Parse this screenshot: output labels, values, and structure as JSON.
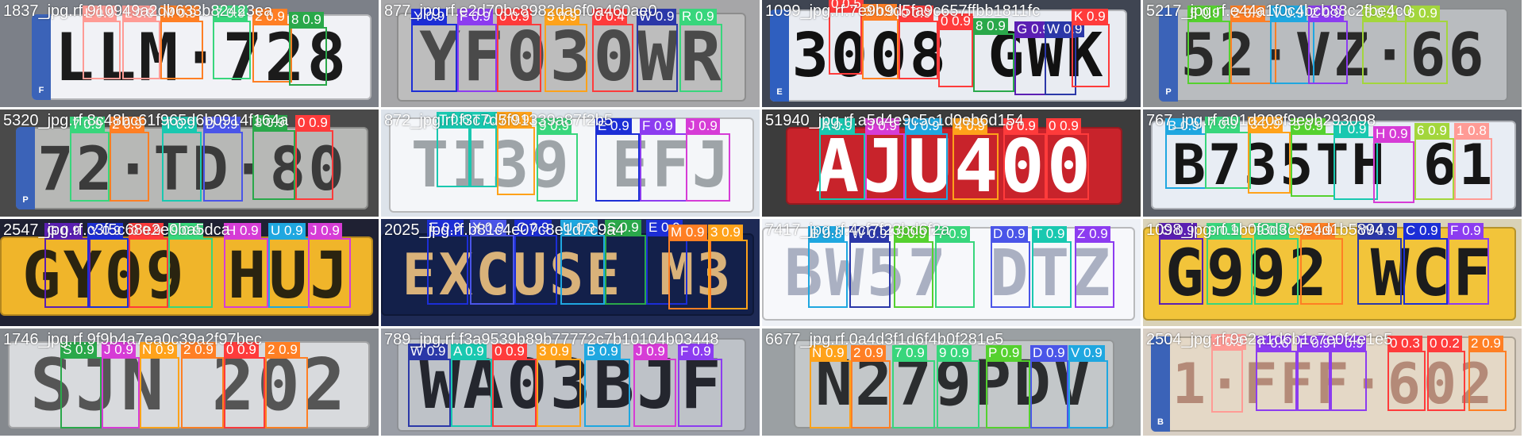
{
  "tiles": [
    {
      "filename": "1837_jpg.rf.910949a2db633b82423ea",
      "background": "#7c8088",
      "plate": {
        "bg": "#f1f2f6",
        "fg": "#1b1b1b",
        "text": "LLM·728",
        "eu_band": "#3b63b8",
        "eu_letter": "F"
      },
      "detections": [
        {
          "label": "L 0.9",
          "color": "#ff9b95"
        },
        {
          "label": "L 0.9",
          "color": "#ff9b95"
        },
        {
          "label": "M 0.9",
          "color": "#ff7f24"
        },
        {
          "label": "7 0.9",
          "color": "#38d67c"
        },
        {
          "label": "2 0.9",
          "color": "#ff7f24"
        },
        {
          "label": "8 0.9",
          "color": "#2aa84a"
        }
      ]
    },
    {
      "filename": "877_jpg.rf.e2d70bc8982da6f0a460ae0",
      "background": "#a6a6a8",
      "plate": {
        "bg": "#bdbdbd",
        "fg": "#4a4a4a",
        "text": "YF030WR",
        "eu_band": "",
        "eu_letter": ""
      },
      "detections": [
        {
          "label": "Y 0.9",
          "color": "#1c2ed6"
        },
        {
          "label": "F 0.9",
          "color": "#8c3cf0"
        },
        {
          "label": "0 0.9",
          "color": "#ff3b3b"
        },
        {
          "label": "3 0.9",
          "color": "#ffa21a"
        },
        {
          "label": "0 0.4",
          "color": "#ff3b3b"
        },
        {
          "label": "W 0.9",
          "color": "#2b38a8"
        },
        {
          "label": "R 0.9",
          "color": "#38d67c"
        }
      ]
    },
    {
      "filename": "1099_jpg.rf.7e9b9d5fa9c657ffbb1811fc",
      "background": "#3f4552",
      "plate": {
        "bg": "#e9ecf2",
        "fg": "#111111",
        "text": "3008 GWK",
        "eu_band": "#2f5fbf",
        "eu_letter": "E"
      },
      "detections": [
        {
          "label": "0 0.5",
          "color": "#ff3b3b"
        },
        {
          "label": "3 0.9",
          "color": "#ff7f24"
        },
        {
          "label": "0 0.9",
          "color": "#ff3b3b"
        },
        {
          "label": "0 0.9",
          "color": "#ff3b3b"
        },
        {
          "label": "8 0.9",
          "color": "#2aa84a"
        },
        {
          "label": "G 0.9",
          "color": "#5b1fb3"
        },
        {
          "label": "W 0.9",
          "color": "#2b38a8"
        },
        {
          "label": "K 0.9",
          "color": "#ff3b3b"
        }
      ]
    },
    {
      "filename": "5217_jpg.rf.e44a1f0c4bcb88c2fbe4c0",
      "background": "#8e9193",
      "plate": {
        "bg": "#b9bcbf",
        "fg": "#2a2a2a",
        "text": "52·VZ·66",
        "eu_band": "#3b63b8",
        "eu_letter": "P"
      },
      "detections": [
        {
          "label": "5 0.9",
          "color": "#55d12f"
        },
        {
          "label": "2 0.9",
          "color": "#ff7f24"
        },
        {
          "label": "V 0.9",
          "color": "#1fa7e0"
        },
        {
          "label": "Z 0.9",
          "color": "#8c3cf0"
        },
        {
          "label": "6 0.9",
          "color": "#a3d63c"
        },
        {
          "label": "6 0.9",
          "color": "#a3d63c"
        }
      ]
    },
    {
      "filename": "5320_jpg.rf.8c48bc61f965d6b0914f164a",
      "background": "#4a4a4a",
      "plate": {
        "bg": "#b7b8b6",
        "fg": "#3b3b3b",
        "text": "72·TD·80",
        "eu_band": "#3b63b8",
        "eu_letter": "P"
      },
      "detections": [
        {
          "label": "7 0.9",
          "color": "#38d67c"
        },
        {
          "label": "2 0.9",
          "color": "#ff7f24"
        },
        {
          "label": "T 0.9",
          "color": "#19c8b0"
        },
        {
          "label": "D 0.9",
          "color": "#4a55e8"
        },
        {
          "label": "8 0.9",
          "color": "#2aa84a"
        },
        {
          "label": "0 0.9",
          "color": "#ff3b3b"
        }
      ]
    },
    {
      "filename": "872_jpg.rf.f3c7d5f91339a87f2b5",
      "background": "#dde3ea",
      "plate": {
        "bg": "#f4f6f9",
        "fg": "#9ea4a8",
        "text": "TI39 EFJ",
        "eu_band": "",
        "eu_letter": ""
      },
      "detections": [
        {
          "label": "T 0.6",
          "color": "#19c8b0"
        },
        {
          "label": "T 0.3",
          "color": "#19c8b0"
        },
        {
          "label": "7 0.9",
          "color": "#ffa21a"
        },
        {
          "label": "9 0.9",
          "color": "#38d67c"
        },
        {
          "label": "E 0.9",
          "color": "#1c2ed6"
        },
        {
          "label": "F 0.9",
          "color": "#8c3cf0"
        },
        {
          "label": "J 0.9",
          "color": "#d63cd6"
        }
      ]
    },
    {
      "filename": "51940_jpg.rf.a5d4e9c5c1d0eb6d154",
      "background": "#3c3c3c",
      "plate": {
        "bg": "#c8232b",
        "fg": "#ffffff",
        "text": "AJU400",
        "eu_band": "",
        "eu_letter": ""
      },
      "detections": [
        {
          "label": "A 0.9",
          "color": "#19c8b0"
        },
        {
          "label": "J 0.9",
          "color": "#d63cd6"
        },
        {
          "label": "U 0.9",
          "color": "#1fa7e0"
        },
        {
          "label": "4 0.9",
          "color": "#ffa21a"
        },
        {
          "label": "0 0.9",
          "color": "#ff3b3b"
        },
        {
          "label": "0 0.9",
          "color": "#ff3b3b"
        }
      ]
    },
    {
      "filename": "767_jpg.rf.a01d208f9e9b293098",
      "background": "#5a5e66",
      "plate": {
        "bg": "#e8edf4",
        "fg": "#161616",
        "text": "B735TH 61",
        "eu_band": "",
        "eu_letter": ""
      },
      "detections": [
        {
          "label": "B 0.9",
          "color": "#1fa7e0"
        },
        {
          "label": "7 0.9",
          "color": "#38d67c"
        },
        {
          "label": "3 0.9",
          "color": "#ffa21a"
        },
        {
          "label": "5 0.9",
          "color": "#55d12f"
        },
        {
          "label": "T 0.9",
          "color": "#19c8b0"
        },
        {
          "label": "H 0.9",
          "color": "#d63cd6"
        },
        {
          "label": "6 0.9",
          "color": "#a3d63c"
        },
        {
          "label": "1 0.8",
          "color": "#ff9b95"
        }
      ]
    },
    {
      "filename": "2547_jpg.rf.c3f5c68e2e0ba5dca",
      "background": "#1f2133",
      "plate": {
        "bg": "#f0b52a",
        "fg": "#2a2410",
        "text": "GY09 HUJ",
        "eu_band": "",
        "eu_letter": ""
      },
      "detections": [
        {
          "label": "G 0.9",
          "color": "#5b1fb3"
        },
        {
          "label": "Y 0.9",
          "color": "#1c2ed6"
        },
        {
          "label": "0 0.9",
          "color": "#ff3b3b"
        },
        {
          "label": "9 0.9",
          "color": "#38d67c"
        },
        {
          "label": "H 0.9",
          "color": "#d63cd6"
        },
        {
          "label": "U 0.9",
          "color": "#1fa7e0"
        },
        {
          "label": "J 0.9",
          "color": "#d63cd6"
        }
      ]
    },
    {
      "filename": "2025_jpg.rf.b81c4e07c8e1d7c9a4",
      "background": "#1e2a55",
      "plate": {
        "bg": "#13204a",
        "fg": "#d9b27a",
        "text": "EXCUSE M3",
        "eu_band": "",
        "eu_letter": ""
      },
      "detections": [
        {
          "label": "E 0.9",
          "color": "#1c2ed6"
        },
        {
          "label": "X 0.9",
          "color": "#4a55e8"
        },
        {
          "label": "C 0.9",
          "color": "#1c2ed6"
        },
        {
          "label": "U 0.9",
          "color": "#1fa7e0"
        },
        {
          "label": "S 0.9",
          "color": "#2aa84a"
        },
        {
          "label": "E 0.9",
          "color": "#1c2ed6"
        },
        {
          "label": "M 0.9",
          "color": "#ff7f24"
        },
        {
          "label": "3 0.9",
          "color": "#ffa21a"
        }
      ]
    },
    {
      "filename": "7417_jpg.rf.4cf7f23bd6f2a",
      "background": "#eef1f6",
      "plate": {
        "bg": "#f7f8fb",
        "fg": "#aab0c2",
        "text": "BW57 DTZ",
        "eu_band": "",
        "eu_letter": ""
      },
      "detections": [
        {
          "label": "B 0.8",
          "color": "#1fa7e0"
        },
        {
          "label": "W 0.9",
          "color": "#2b38a8"
        },
        {
          "label": "5 0.9",
          "color": "#55d12f"
        },
        {
          "label": "7 0.9",
          "color": "#38d67c"
        },
        {
          "label": "D 0.9",
          "color": "#4a55e8"
        },
        {
          "label": "T 0.9",
          "color": "#19c8b0"
        },
        {
          "label": "Z 0.9",
          "color": "#8c3cf0"
        }
      ]
    },
    {
      "filename": "1098_jpg.rf.1b0f3d3c9e4d1b5894",
      "background": "#d9d2b8",
      "plate": {
        "bg": "#f2c43a",
        "fg": "#1c1c1c",
        "text": "G992 WCF",
        "eu_band": "",
        "eu_letter": ""
      },
      "detections": [
        {
          "label": "G 0.9",
          "color": "#5b1fb3"
        },
        {
          "label": "9 0.9",
          "color": "#38d67c"
        },
        {
          "label": "9 0.9",
          "color": "#38d67c"
        },
        {
          "label": "2 0.9",
          "color": "#ff7f24"
        },
        {
          "label": "W 0.9",
          "color": "#2b38a8"
        },
        {
          "label": "C 0.9",
          "color": "#1c2ed6"
        },
        {
          "label": "F 0.9",
          "color": "#8c3cf0"
        }
      ]
    },
    {
      "filename": "1746_jpg.rf.9f9b4a7ea0c39a2f97bec",
      "background": "#85898e",
      "plate": {
        "bg": "#d8dadd",
        "fg": "#555555",
        "text": "SJN 202",
        "eu_band": "",
        "eu_letter": ""
      },
      "detections": [
        {
          "label": "S 0.9",
          "color": "#2aa84a"
        },
        {
          "label": "J 0.9",
          "color": "#d63cd6"
        },
        {
          "label": "N 0.9",
          "color": "#ffa21a"
        },
        {
          "label": "2 0.9",
          "color": "#ff7f24"
        },
        {
          "label": "0 0.9",
          "color": "#ff3b3b"
        },
        {
          "label": "2 0.9",
          "color": "#ff7f24"
        }
      ]
    },
    {
      "filename": "789_jpg.rf.f3a9539b89b77772c7b10104b03448",
      "background": "#9a9ea6",
      "plate": {
        "bg": "#bec2c8",
        "fg": "#24262e",
        "text": "WA03BJF",
        "eu_band": "",
        "eu_letter": ""
      },
      "detections": [
        {
          "label": "W 0.9",
          "color": "#2b38a8"
        },
        {
          "label": "A 0.9",
          "color": "#19c8b0"
        },
        {
          "label": "0 0.9",
          "color": "#ff3b3b"
        },
        {
          "label": "3 0.9",
          "color": "#ffa21a"
        },
        {
          "label": "B 0.9",
          "color": "#1fa7e0"
        },
        {
          "label": "J 0.9",
          "color": "#d63cd6"
        },
        {
          "label": "F 0.9",
          "color": "#8c3cf0"
        }
      ]
    },
    {
      "filename": "6677_jpg.rf.0a4d3f1d6f4b0f281e5",
      "background": "#9ba0a3",
      "plate": {
        "bg": "#c3c7c9",
        "fg": "#2b2d2f",
        "text": "N279PDV",
        "eu_band": "",
        "eu_letter": ""
      },
      "detections": [
        {
          "label": "N 0.9",
          "color": "#ffa21a"
        },
        {
          "label": "2 0.9",
          "color": "#ff7f24"
        },
        {
          "label": "7 0.9",
          "color": "#38d67c"
        },
        {
          "label": "9 0.9",
          "color": "#38d67c"
        },
        {
          "label": "P 0.9",
          "color": "#55d12f"
        },
        {
          "label": "D 0.9",
          "color": "#4a55e8"
        },
        {
          "label": "V 0.9",
          "color": "#1fa7e0"
        }
      ]
    },
    {
      "filename": "2504_jpg.rf.9e2a1d6b1c7e0f4e1e5",
      "background": "#d8cfc4",
      "plate": {
        "bg": "#e4d8c6",
        "fg": "#b48a78",
        "text": "1·FFF·602",
        "eu_band": "#3b63b8",
        "eu_letter": "B"
      },
      "detections": [
        {
          "label": "1 0.9",
          "color": "#ff9b95"
        },
        {
          "label": "F 0.6",
          "color": "#8c3cf0"
        },
        {
          "label": "F 0.9",
          "color": "#8c3cf0"
        },
        {
          "label": "F 0.9",
          "color": "#8c3cf0"
        },
        {
          "label": "0 0.3",
          "color": "#ff3b3b"
        },
        {
          "label": "0 0.2",
          "color": "#ff3b3b"
        },
        {
          "label": "2 0.9",
          "color": "#ff7f24"
        }
      ]
    }
  ]
}
